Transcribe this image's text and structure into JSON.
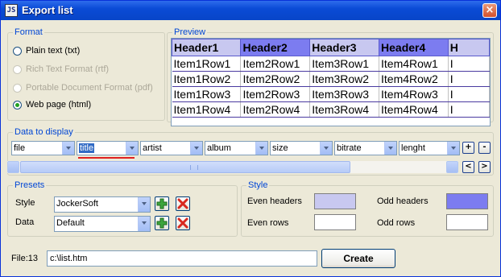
{
  "window": {
    "title": "Export list",
    "app_icon_text": "JS"
  },
  "format": {
    "legend": "Format",
    "options": [
      {
        "label": "Plain text (txt)",
        "enabled": true,
        "checked": false
      },
      {
        "label": "Rich Text Format (rtf)",
        "enabled": false,
        "checked": false
      },
      {
        "label": "Portable Document Format (pdf)",
        "enabled": false,
        "checked": false
      },
      {
        "label": "Web page (html)",
        "enabled": true,
        "checked": true
      }
    ]
  },
  "preview": {
    "legend": "Preview",
    "headers": [
      "Header1",
      "Header2",
      "Header3",
      "Header4",
      "H"
    ],
    "rows": [
      [
        "Item1Row1",
        "Item2Row1",
        "Item3Row1",
        "Item4Row1",
        "I"
      ],
      [
        "Item1Row2",
        "Item2Row2",
        "Item3Row2",
        "Item4Row2",
        "I"
      ],
      [
        "Item1Row3",
        "Item2Row3",
        "Item3Row3",
        "Item4Row3",
        "I"
      ],
      [
        "Item1Row4",
        "Item2Row4",
        "Item3Row4",
        "Item4Row4",
        "I"
      ]
    ],
    "even_header_color": "#C8C8F0",
    "odd_header_color": "#7C7CF0"
  },
  "data_to_display": {
    "legend": "Data to display",
    "columns": [
      "file",
      "title",
      "artist",
      "album",
      "size",
      "bitrate",
      "lenght"
    ],
    "add_label": "+",
    "remove_label": "-",
    "scroll_left_label": "<",
    "scroll_right_label": ">"
  },
  "presets": {
    "legend": "Presets",
    "style_label": "Style",
    "style_value": "JockerSoft",
    "data_label": "Data",
    "data_value": "Default"
  },
  "style": {
    "legend": "Style",
    "even_headers_label": "Even headers",
    "odd_headers_label": "Odd headers",
    "even_rows_label": "Even rows",
    "odd_rows_label": "Odd rows",
    "even_headers_color": "#C8C8F0",
    "odd_headers_color": "#7C7CF0",
    "even_rows_color": "#FFFFFF",
    "odd_rows_color": "#FFFFFF"
  },
  "file": {
    "label": "File:13",
    "value": "c:\\list.htm"
  },
  "create_label": "Create"
}
